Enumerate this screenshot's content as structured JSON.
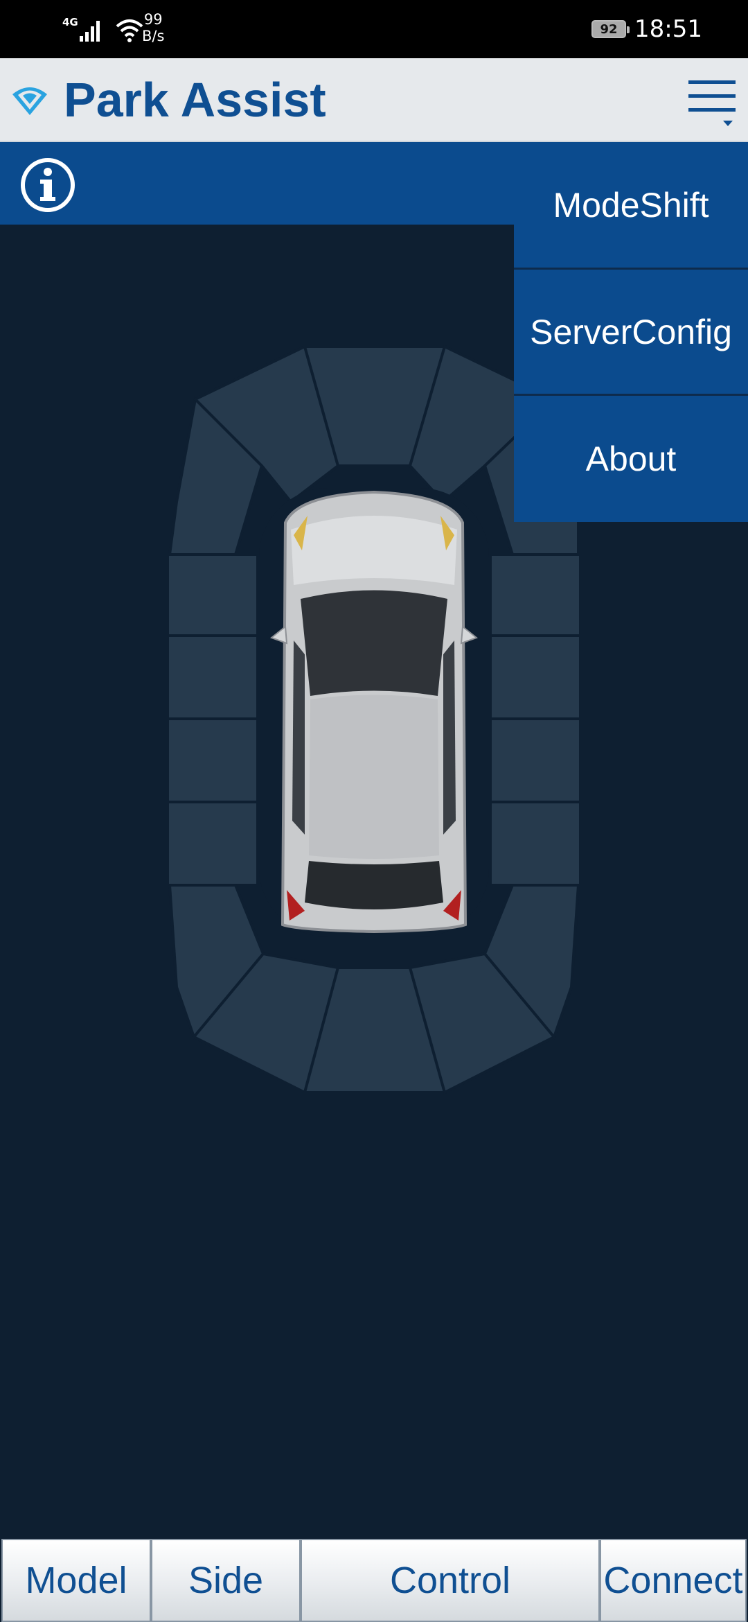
{
  "status_bar": {
    "network_type": "4G",
    "speed_value": "99",
    "speed_unit": "B/s",
    "battery": "92",
    "time": "18:51"
  },
  "header": {
    "title": "Park Assist",
    "logo_icon": "wifi-shield-icon",
    "menu_icon": "hamburger-menu-icon"
  },
  "info_bar": {
    "icon": "info-icon"
  },
  "menu": {
    "items": [
      "ModeShift",
      "ServerConfig",
      "About"
    ]
  },
  "tabs": [
    "Model",
    "Side",
    "Control",
    "Connect"
  ],
  "colors": {
    "brand_blue": "#0b4b8e",
    "title_blue": "#0f4f92",
    "background": "#0e1f31",
    "sensor_zone": "#263a4d",
    "header_bg": "#e6e9ec"
  }
}
